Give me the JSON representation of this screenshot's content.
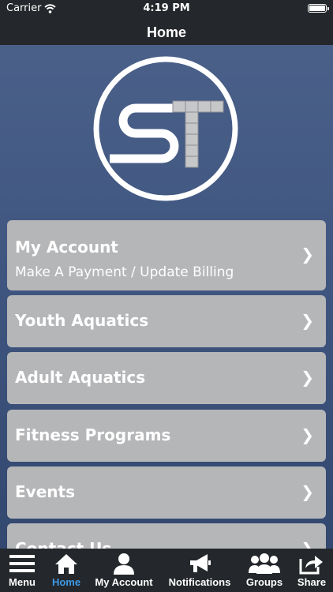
{
  "status_bar": {
    "carrier": "Carrier",
    "time": "4:19 PM"
  },
  "nav": {
    "title": "Home"
  },
  "logo": {
    "letters": "ST"
  },
  "menu": [
    {
      "label": "My Account",
      "sublabel": "Make A Payment / Update Billing",
      "chevron": "❯"
    },
    {
      "label": "Youth Aquatics",
      "chevron": "❯"
    },
    {
      "label": "Adult Aquatics",
      "chevron": "❯"
    },
    {
      "label": "Fitness Programs",
      "chevron": "❯"
    },
    {
      "label": "Events",
      "chevron": "❯"
    },
    {
      "label": "Contact Us",
      "chevron": "❯"
    }
  ],
  "tabs": [
    {
      "label": "Menu",
      "icon": "hamburger-icon"
    },
    {
      "label": "Home",
      "icon": "home-icon",
      "active": true
    },
    {
      "label": "My Account",
      "icon": "person-icon"
    },
    {
      "label": "Notifications",
      "icon": "megaphone-icon"
    },
    {
      "label": "Groups",
      "icon": "group-icon"
    },
    {
      "label": "Share",
      "icon": "share-icon"
    }
  ],
  "colors": {
    "header_bg": "#24272b",
    "content_bg": "#4a6089",
    "menu_item_bg": "#b5b6b8",
    "active_tab": "#3d9ae8"
  }
}
